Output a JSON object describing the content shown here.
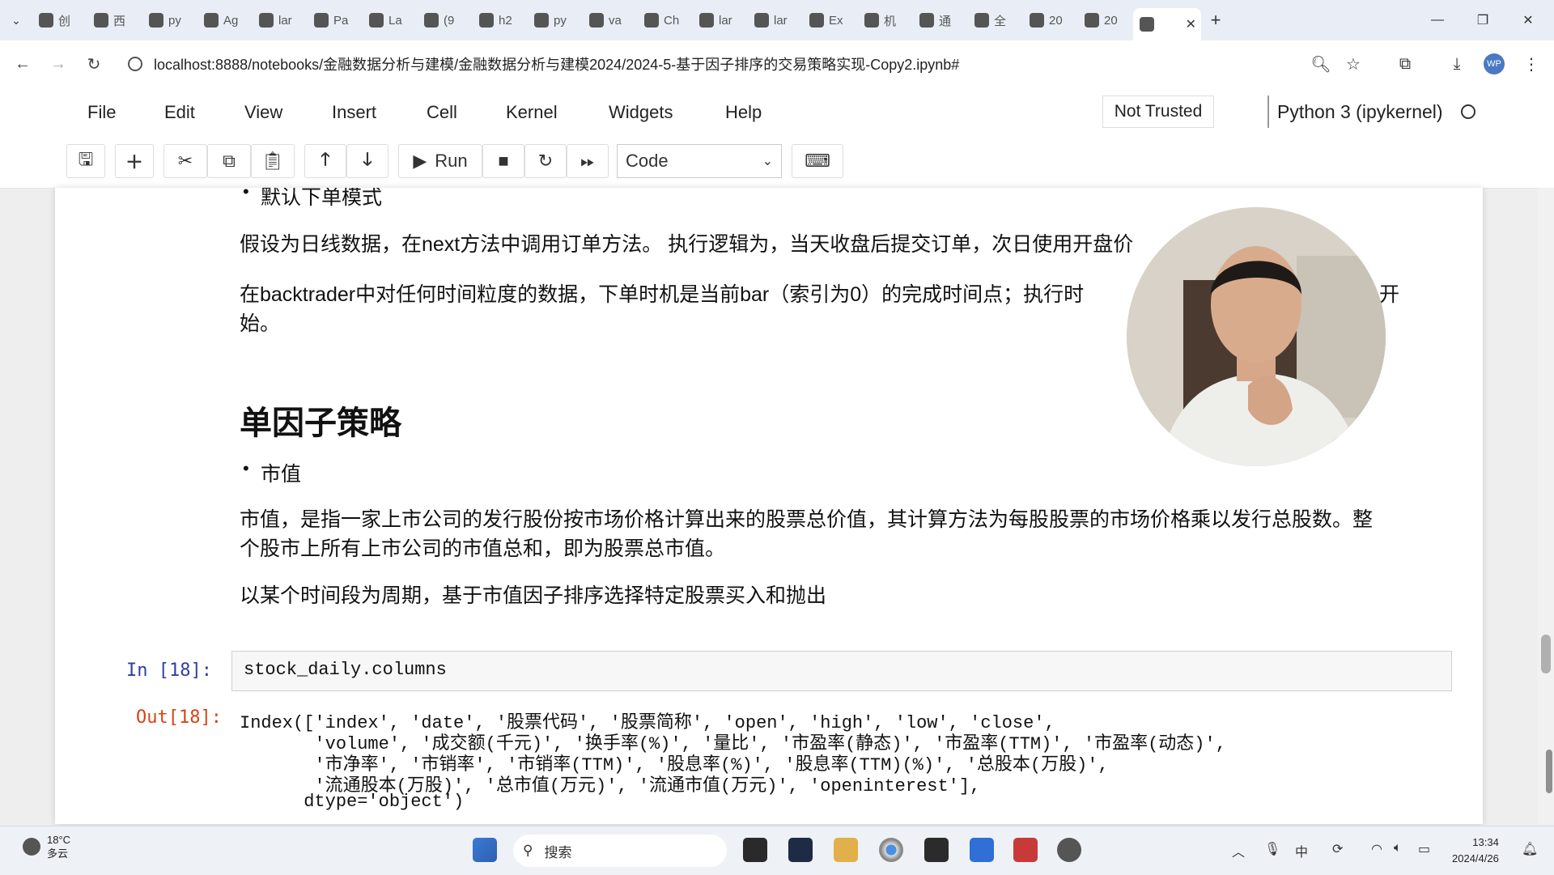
{
  "browser": {
    "tabs": [
      {
        "icon": "calendar-icon",
        "label": "创"
      },
      {
        "icon": "chrome-ext-icon",
        "label": "西"
      },
      {
        "icon": "github-icon",
        "label": "py"
      },
      {
        "icon": "mail-icon",
        "label": "Ag"
      },
      {
        "icon": "github-icon",
        "label": "lar"
      },
      {
        "icon": "mail-icon",
        "label": "Pa"
      },
      {
        "icon": "x-icon",
        "label": "La"
      },
      {
        "icon": "zhihu-icon",
        "label": "(9"
      },
      {
        "icon": "github-icon",
        "label": "h2"
      },
      {
        "icon": "c-icon",
        "label": "py"
      },
      {
        "icon": "github-icon",
        "label": "va"
      },
      {
        "icon": "mail-icon",
        "label": "Ch"
      },
      {
        "icon": "book-icon",
        "label": "lar"
      },
      {
        "icon": "book-icon",
        "label": "lar"
      },
      {
        "icon": "person-icon",
        "label": "Ex"
      },
      {
        "icon": "bracket-icon",
        "label": "机"
      },
      {
        "icon": "feather-icon",
        "label": "通"
      },
      {
        "icon": "loading-icon",
        "label": "全"
      },
      {
        "icon": "notebook-icon",
        "label": "20"
      },
      {
        "icon": "notebook-icon",
        "label": "20"
      }
    ],
    "active_tab_close": "✕",
    "new_tab": "+",
    "url": "localhost:8888/notebooks/金融数据分析与建模/金融数据分析与建模2024/2024-5-基于因子排序的交易策略实现-Copy2.ipynb#",
    "profile": "WP"
  },
  "jupyter": {
    "menu": [
      "File",
      "Edit",
      "View",
      "Insert",
      "Cell",
      "Kernel",
      "Widgets",
      "Help"
    ],
    "trust": "Not Trusted",
    "kernel": "Python 3 (ipykernel)",
    "toolbar": {
      "run_label": "Run",
      "cell_type": "Code"
    }
  },
  "notebook": {
    "bullet_default_order": "默认下单模式",
    "para1": "假设为日线数据，在next方法中调用订单方法。 执行逻辑为，当天收盘后提交订单，次日使用开盘价",
    "para2_line1": "在backtrader中对任何时间粒度的数据，下单时机是当前bar（索引为0）的完成时间点；执行时",
    "para2_tail": "开",
    "para2_line2": "始。",
    "heading": "单因子策略",
    "bullet_market_cap": "市值",
    "para3_line1": "市值，是指一家上市公司的发行股份按市场价格计算出来的股票总价值，其计算方法为每股股票的市场价格乘以发行总股数。整",
    "para3_line2": "个股市上所有上市公司的市值总和，即为股票总市值。",
    "para4": "以某个时间段为周期，基于市值因子排序选择特定股票买入和抛出",
    "in_prompt": "In  [18]:",
    "code": "stock_daily.columns",
    "out_prompt": "Out[18]:",
    "output_lines": [
      "Index(['index', 'date', '股票代码', '股票简称', 'open', 'high', 'low', 'close',",
      "       'volume', '成交额(千元)', '换手率(%)', '量比', '市盈率(静态)', '市盈率(TTM)', '市盈率(动态)',",
      "       '市净率', '市销率', '市销率(TTM)', '股息率(%)', '股息率(TTM)(%)', '总股本(万股)',",
      "       '流通股本(万股)', '总市值(万元)', '流通市值(万元)', 'openinterest'],",
      "      dtype='object')"
    ]
  },
  "taskbar": {
    "temperature": "18°C",
    "weather": "多云",
    "search_placeholder": "搜索",
    "time": "13:34",
    "date": "2024/4/26"
  }
}
